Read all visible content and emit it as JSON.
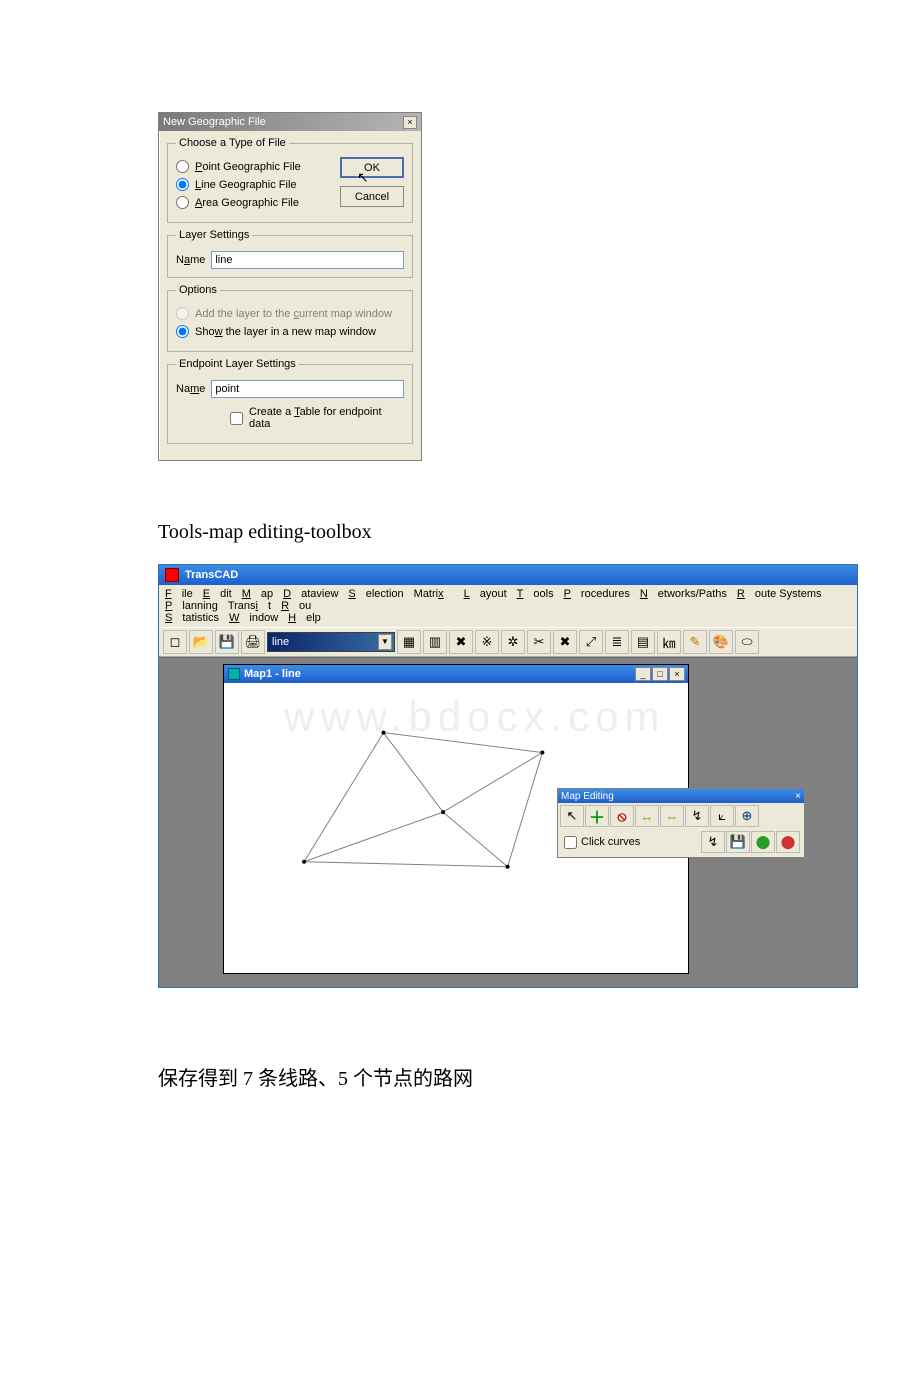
{
  "dialog": {
    "title": "New Geographic File",
    "group_type": {
      "legend": "Choose a Type of File",
      "point": {
        "label_pre": "P",
        "label_post": "oint Geographic File",
        "selected": false
      },
      "line": {
        "label_pre": "L",
        "label_post": "ine Geographic File",
        "selected": true
      },
      "area": {
        "label_pre": "A",
        "label_post": "rea Geographic File",
        "selected": false
      }
    },
    "layer_settings": {
      "legend": "Layer Settings",
      "name_label_pre": "N",
      "name_label_u": "a",
      "name_label_post": "me",
      "name_value": "line"
    },
    "options": {
      "legend": "Options",
      "add": {
        "pre": "Add the layer to the ",
        "u": "c",
        "post": "urrent map window",
        "selected": false,
        "disabled": true
      },
      "new": {
        "pre": "Sho",
        "u": "w",
        "post": " the layer in a new map window",
        "selected": true
      }
    },
    "endpoint": {
      "legend": "Endpoint Layer Settings",
      "name_label_pre": "Na",
      "name_label_u": "m",
      "name_label_post": "e",
      "name_value": "point",
      "create_table_pre": "Create a ",
      "create_table_u": "T",
      "create_table_post": "able for endpoint data",
      "create_table_checked": false
    },
    "buttons": {
      "ok": "OK",
      "cancel": "Cancel"
    },
    "close_x": "×"
  },
  "mid_text": "Tools-map editing-toolbox",
  "app": {
    "title": "TransCAD",
    "menus": [
      "File",
      "Edit",
      "Map",
      "Dataview",
      "Selection",
      "Matrix",
      "Layout",
      "Tools",
      "Procedures",
      "Networks/Paths",
      "Route Systems",
      "Planning",
      "Transit",
      "Rou",
      "Statistics",
      "Window",
      "Help"
    ],
    "menu_underlines": [
      "F",
      "E",
      "M",
      "D",
      "S",
      "x",
      "L",
      "T",
      "P",
      "N",
      "R",
      "P",
      "i",
      "R",
      "S",
      "W",
      "H"
    ],
    "layer_combo": "line",
    "map_window_title": "Map1 - line",
    "watermark": "www.bdocx.com",
    "toolbar_icons": [
      "new-file",
      "open-file",
      "save",
      "print",
      "layer-select",
      "layers",
      "legend",
      "pan",
      "zoom-box",
      "zoom-full",
      "zoom-prev",
      "info",
      "select",
      "label",
      "table",
      "scale",
      "pencil",
      "color",
      "ellipse"
    ],
    "toolbar_glyphs": [
      "◻",
      "📂",
      "💾",
      "🖨",
      "",
      "▦",
      "▥",
      "✖",
      "※",
      "✲",
      "✂",
      "✖",
      "⤢",
      "≣",
      "▤",
      "㎞",
      "✎",
      "🎨",
      "⬭"
    ],
    "editing": {
      "title": "Map Editing",
      "close_x": "×",
      "row1_names": [
        "pointer",
        "add",
        "delete",
        "join",
        "split",
        "move-node",
        "reshape",
        "attributes"
      ],
      "row1_glyphs": [
        "↖",
        "＋",
        "⦸",
        "↔",
        "⇔",
        "↯",
        "⟀",
        "⊕"
      ],
      "click_curves_label": "Click curves",
      "click_curves_checked": false,
      "row2_names": [
        "undo",
        "save-edits",
        "green-light",
        "red-light"
      ],
      "row2_glyphs": [
        "↯",
        "💾",
        "⬤",
        "⬤"
      ]
    }
  },
  "cn_text": "保存得到 7 条线路、5 个节点的路网"
}
